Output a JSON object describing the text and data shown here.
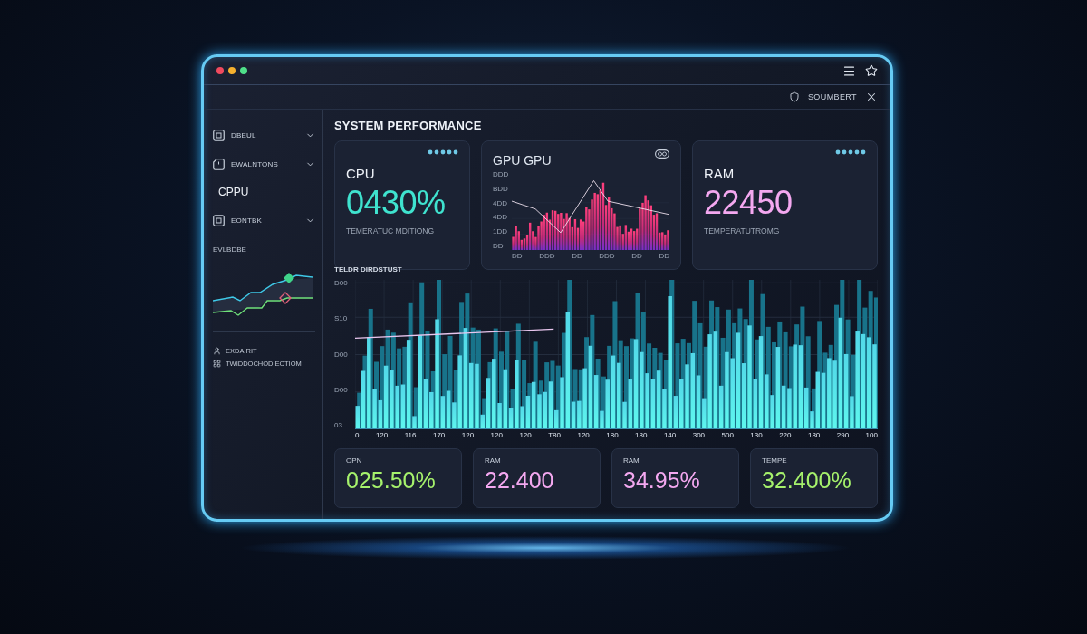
{
  "window_controls": [
    {
      "color": "#f04a5e"
    },
    {
      "color": "#f5b02e"
    },
    {
      "color": "#4fe08a"
    }
  ],
  "account": {
    "label": "SOUMBERT"
  },
  "sidebar": {
    "items": [
      {
        "kind": "menu",
        "label": "DBEUL"
      },
      {
        "kind": "menu",
        "label": "EWALNTONS"
      },
      {
        "kind": "heading",
        "label": "CPPU"
      },
      {
        "kind": "menu",
        "label": "EONTBK"
      }
    ],
    "chart_label": "EVLBDBE",
    "footer": [
      {
        "label": "EXDAIRIT"
      },
      {
        "label": "TWIDDOCHOD.ECTIOM"
      }
    ]
  },
  "title": "SYSTEM PERFORMANCE",
  "top_cards": [
    {
      "kind": "stat",
      "label": "CPU",
      "value": "0430%",
      "caption": "TEMERATUC MDITIONG",
      "color": "#3fe3cf"
    },
    {
      "kind": "chart",
      "label": "GPU GPU",
      "y_axis_labels": [
        "DDD",
        "BDD",
        "4DD",
        "4DD",
        "1DD",
        "DD"
      ],
      "x_axis_labels": [
        "DD",
        "DDD",
        "DD",
        "DDD",
        "DD",
        "DD"
      ]
    },
    {
      "kind": "stat",
      "label": "RAM",
      "value": "22450",
      "caption": "TEMPERATUTROMG",
      "color": "#f4a8f0"
    }
  ],
  "main_chart": {
    "title": "TELDR DIRDSTUST",
    "y_axis_labels": [
      "D00",
      "S10",
      "D00",
      "D00",
      "03"
    ],
    "x_axis_labels": [
      "0",
      "120",
      "116",
      "170",
      "120",
      "120",
      "120",
      "T80",
      "120",
      "180",
      "180",
      "140",
      "300",
      "500",
      "130",
      "220",
      "180",
      "290",
      "100"
    ]
  },
  "bottom_cards": [
    {
      "label": "OPN",
      "value": "025.50%",
      "color": "#a6f26c"
    },
    {
      "label": "RAM",
      "value": "22.400",
      "color": "#f4a8f0"
    },
    {
      "label": "RAM",
      "value": "34.95%",
      "color": "#f4a8f0"
    },
    {
      "label": "TEMPE",
      "value": "32.400%",
      "color": "#a6f26c"
    }
  ]
}
